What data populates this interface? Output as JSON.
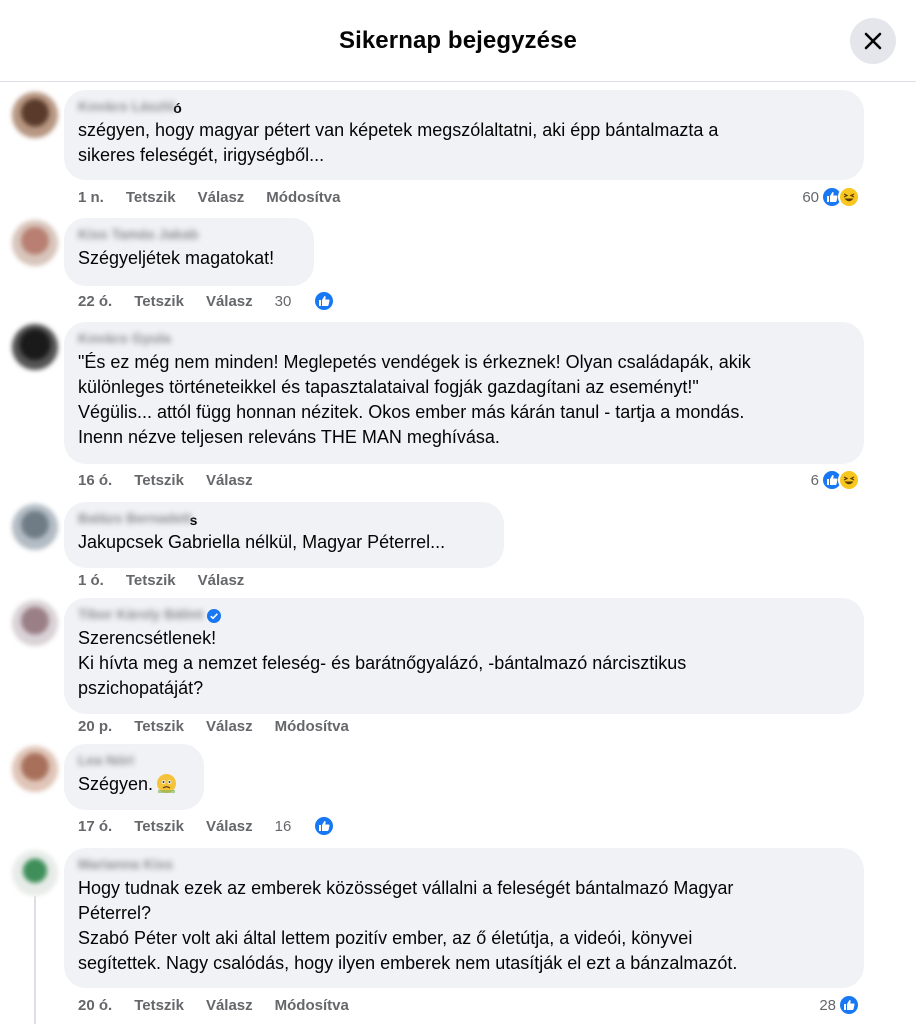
{
  "header": {
    "title": "Sikernap bejegyzése",
    "close_icon": "close-icon"
  },
  "actions": {
    "like": "Tetszik",
    "reply": "Válasz",
    "edited": "Módosítva"
  },
  "comments": [
    {
      "author": "Kovács László",
      "author_tail": "ó",
      "time": "1 n.",
      "text": "szégyen, hogy magyar pétert van képetek megszólaltatni, aki épp bántalmazta a\nsikeres feleségét, irigységből...",
      "reactions": "60",
      "edited": true,
      "icons": [
        "like-icon",
        "haha-icon"
      ]
    },
    {
      "author": "Kiss Tamás Jakab",
      "time": "22 ó.",
      "text": "Szégyeljétek magatokat!",
      "reactions": "30",
      "edited": false,
      "icons": [
        "like-icon"
      ]
    },
    {
      "author": "Kovács Gyula",
      "time": "16 ó.",
      "text": "\"És ez még nem minden! Meglepetés vendégek is érkeznek! Olyan családapák, akik\nkülönleges történeteikkel és tapasztalataival fogják gazdagítani az eseményt!\"\nVégülis... attól függ honnan nézitek. Okos ember más kárán tanul - tartja a mondás.\nInenn nézve teljesen releváns THE MAN meghívása.",
      "reactions": "6",
      "edited": false,
      "icons": [
        "like-icon",
        "haha-icon"
      ]
    },
    {
      "author": "Balázs Bernadett",
      "author_tail": "s",
      "time": "1 ó.",
      "text": "Jakupcsek Gabriella nélkül, Magyar Péterrel...",
      "reactions": "",
      "edited": false,
      "icons": []
    },
    {
      "author": "Tibor Károly Bálint",
      "time": "20 p.",
      "text": "Szerencsétlenek!\nKi hívta meg a nemzet feleség- és barátnőgyalázó, -bántalmazó nárcisztikus\npszichopatáját?",
      "reactions": "",
      "edited": true,
      "verified": true,
      "icons": []
    },
    {
      "author": "Lea Nóri",
      "time": "17 ó.",
      "text": "Szégyen.",
      "reactions": "16",
      "edited": false,
      "icons": [
        "like-icon"
      ]
    },
    {
      "author": "Marianna Kiss",
      "time": "20 ó.",
      "text": "Hogy tudnak ezek az emberek közösséget vállalni a feleségét bántalmazó Magyar\nPéterrel?\nSzabó Péter volt aki által lettem pozitív ember, az ő életútja, a videói, könyvei\nsegítettek. Nagy csalódás, hogy ilyen emberek nem utasítják el ezt a bánzalmazót.",
      "reactions": "28",
      "edited": true,
      "icons": [
        "like-icon"
      ]
    }
  ],
  "colors": {
    "accent": "#1877f2",
    "bubble": "#f0f2f5",
    "meta": "#65676b",
    "haha": "#f7c61f"
  }
}
